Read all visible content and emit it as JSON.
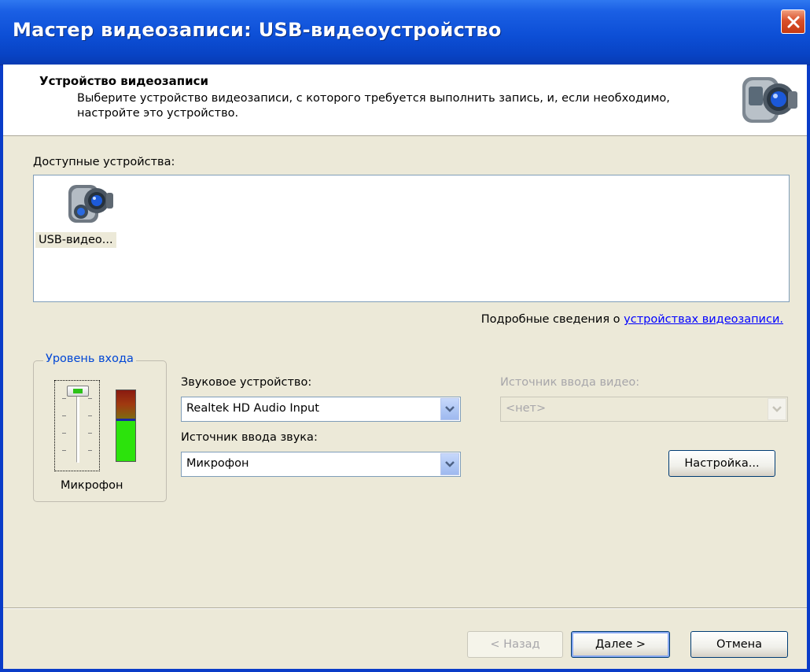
{
  "window": {
    "title": "Мастер видеозаписи: USB-видеоустройство"
  },
  "header": {
    "title": "Устройство видеозаписи",
    "description": "Выберите устройство видеозаписи, с которого требуется выполнить запись, и, если необходимо, настройте это устройство."
  },
  "devices": {
    "label": "Доступные устройства:",
    "items": [
      {
        "label": "USB-видео..."
      }
    ]
  },
  "info": {
    "prefix": "Подробные сведения о ",
    "link": "устройствах видеозаписи."
  },
  "input_level": {
    "group_label": "Уровень входа",
    "caption": "Микрофон"
  },
  "audio_device": {
    "label": "Звуковое устройство:",
    "value": "Realtek HD Audio Input"
  },
  "audio_source": {
    "label": "Источник ввода звука:",
    "value": "Микрофон"
  },
  "video_source": {
    "label": "Источник ввода видео:",
    "value": "<нет>"
  },
  "buttons": {
    "settings": "Настройка...",
    "back": "< Назад",
    "next": "Далее >",
    "cancel": "Отмена"
  }
}
